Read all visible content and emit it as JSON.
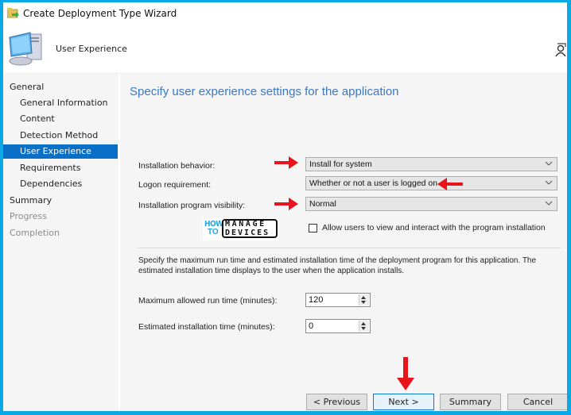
{
  "window": {
    "title": "Create Deployment Type Wizard",
    "header_title": "User Experience"
  },
  "sidebar": {
    "items": [
      {
        "label": "General",
        "level": "top",
        "state": "normal"
      },
      {
        "label": "General Information",
        "level": "sub",
        "state": "normal"
      },
      {
        "label": "Content",
        "level": "sub",
        "state": "normal"
      },
      {
        "label": "Detection Method",
        "level": "sub",
        "state": "normal"
      },
      {
        "label": "User Experience",
        "level": "sub",
        "state": "active"
      },
      {
        "label": "Requirements",
        "level": "sub",
        "state": "normal"
      },
      {
        "label": "Dependencies",
        "level": "sub",
        "state": "normal"
      },
      {
        "label": "Summary",
        "level": "top",
        "state": "normal"
      },
      {
        "label": "Progress",
        "level": "top",
        "state": "disabled"
      },
      {
        "label": "Completion",
        "level": "top",
        "state": "disabled"
      }
    ]
  },
  "main": {
    "page_title": "Specify user experience settings for the application",
    "fields": {
      "installation_behavior": {
        "label": "Installation behavior:",
        "value": "Install for system"
      },
      "logon_requirement": {
        "label": "Logon requirement:",
        "value": "Whether or not a user is logged on"
      },
      "program_visibility": {
        "label": "Installation program visibility:",
        "value": "Normal"
      }
    },
    "allow_interact": {
      "label": "Allow users to view and interact with the program installation",
      "checked": false
    },
    "watermark": {
      "how": "HOW",
      "to": "TO",
      "manage": "MANAGE",
      "devices": "DEVICES"
    },
    "description": "Specify the maximum run time and estimated installation time of the deployment program for this application. The estimated installation time displays to the user when the application installs.",
    "max_run_time": {
      "label": "Maximum allowed run time (minutes):",
      "value": "120"
    },
    "est_install_time": {
      "label": "Estimated installation time (minutes):",
      "value": "0"
    }
  },
  "buttons": {
    "previous": "< Previous",
    "next": "Next >",
    "summary": "Summary",
    "cancel": "Cancel"
  },
  "colors": {
    "frame": "#0ba8e6",
    "active_nav": "#0a6fc7",
    "title_blue": "#3b78c4",
    "annotation_arrow": "#e8141b"
  }
}
